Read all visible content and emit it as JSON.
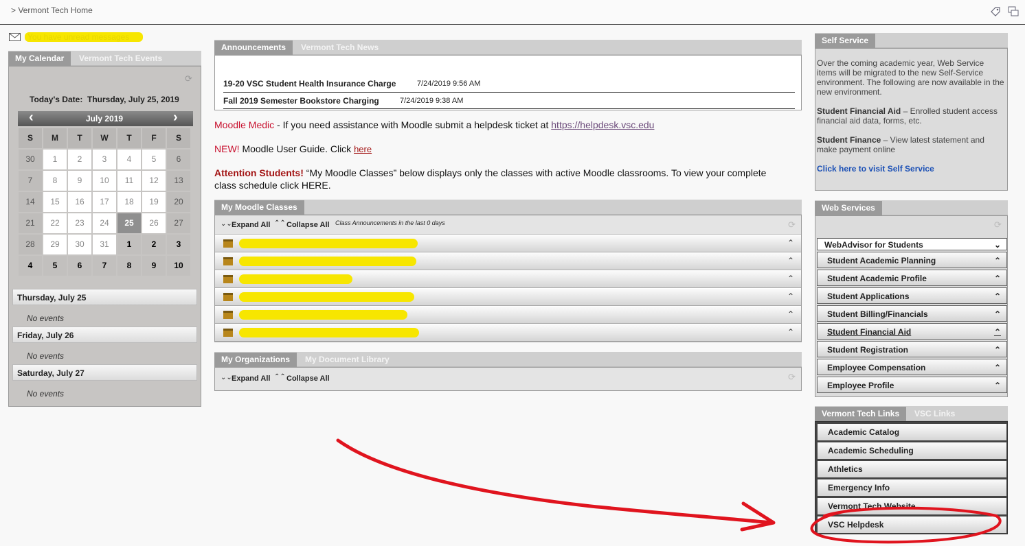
{
  "header": {
    "breadcrumb": "> Vermont Tech Home"
  },
  "messages": {
    "text": "You have unread messages"
  },
  "calendar": {
    "tabs": [
      "My Calendar",
      "Vermont Tech Events"
    ],
    "today_label": "Today's Date:",
    "today_value": "Thursday, July 25, 2019",
    "month_label": "July 2019",
    "prev_icon": "‹",
    "next_icon": "›",
    "weekday_headers": [
      "S",
      "M",
      "T",
      "W",
      "T",
      "F",
      "S"
    ],
    "weeks": [
      [
        "30",
        "1",
        "2",
        "3",
        "4",
        "5",
        "6"
      ],
      [
        "7",
        "8",
        "9",
        "10",
        "11",
        "12",
        "13"
      ],
      [
        "14",
        "15",
        "16",
        "17",
        "18",
        "19",
        "20"
      ],
      [
        "21",
        "22",
        "23",
        "24",
        "25",
        "26",
        "27"
      ],
      [
        "28",
        "29",
        "30",
        "31",
        "1",
        "2",
        "3"
      ],
      [
        "4",
        "5",
        "6",
        "7",
        "8",
        "9",
        "10"
      ]
    ],
    "days": [
      {
        "label": "Thursday, July 25",
        "events": "No events"
      },
      {
        "label": "Friday, July 26",
        "events": "No events"
      },
      {
        "label": "Saturday, July 27",
        "events": "No events"
      }
    ]
  },
  "announcements": {
    "tabs": [
      "Announcements",
      "Vermont Tech News"
    ],
    "items": [
      {
        "title": "19-20 VSC Student Health Insurance Charge",
        "date": "7/24/2019 9:56 AM"
      },
      {
        "title": "Fall 2019 Semester Bookstore Charging",
        "date": "7/24/2019 9:38 AM"
      }
    ]
  },
  "notices": {
    "moodle_medic_label": "Moodle Medic",
    "moodle_medic_text": " - If you need assistance with Moodle submit a helpdesk ticket at ",
    "moodle_medic_link": "https://helpdesk.vsc.edu",
    "new_label": "NEW!",
    "new_text": " Moodle User Guide. Click ",
    "new_link": "here",
    "attention_label": "Attention Students!",
    "attention_text": "  “My Moodle Classes” below displays only the classes with active Moodle classrooms.  To view your complete",
    "attention_text2": "class schedule click ",
    "attention_link": "HERE."
  },
  "moodle_classes": {
    "tab": "My Moodle Classes",
    "expand_all": "Expand All",
    "collapse_all": "Collapse All",
    "note": "Class Announcements in the last 0 days",
    "course_count": 6
  },
  "organizations": {
    "tabs": [
      "My Organizations",
      "My Document Library"
    ],
    "expand_all": "Expand All",
    "collapse_all": "Collapse All"
  },
  "self_service": {
    "tab": "Self Service",
    "intro": "Over the coming academic year, Web Service items will be migrated to the new Self-Service environment. The following are now available in the new environment.",
    "financial_aid_label": "Student Financial Aid",
    "financial_aid_text": " – Enrolled student access financial aid data, forms, etc.",
    "finance_label": "Student Finance",
    "finance_text": " – View latest statement and make payment online",
    "link": "Click here to visit Self Service"
  },
  "web_services": {
    "tab": "Web Services",
    "header": "WebAdvisor for Students",
    "items": [
      "Student Academic Planning",
      "Student Academic Profile",
      "Student Applications",
      "Student Billing/Financials",
      "Student Financial Aid",
      "Student Registration",
      "Employee Compensation",
      "Employee Profile"
    ]
  },
  "links": {
    "tabs": [
      "Vermont Tech Links",
      "VSC Links"
    ],
    "items": [
      "Academic Catalog",
      "Academic Scheduling",
      "Athletics",
      "Emergency Info",
      "Vermont Tech Website",
      "VSC Helpdesk"
    ]
  },
  "colors": {
    "annotation": "#e0141e",
    "redaction": "#f7e600",
    "link_blue": "#1a4fb5"
  }
}
